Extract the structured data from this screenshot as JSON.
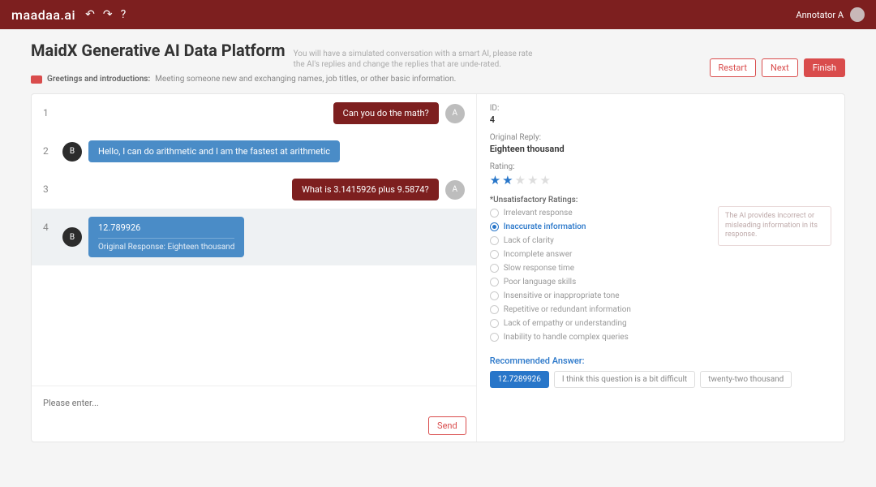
{
  "topbar": {
    "logo": "maadaa.ai",
    "user": "Annotator A"
  },
  "header": {
    "title": "MaidX Generative AI Data Platform",
    "subtitle": "You will have a simulated conversation with a smart AI, please rate the AI's replies and change the replies that are unde-rated.",
    "tag_label": "Greetings and introductions:",
    "tag_desc": "Meeting someone new and exchanging names, job titles, or other basic information.",
    "restart": "Restart",
    "next": "Next",
    "finish": "Finish"
  },
  "chat": {
    "messages": [
      {
        "num": "1",
        "side": "user",
        "avatar": "A",
        "text": "Can you do the math?"
      },
      {
        "num": "2",
        "side": "ai",
        "avatar": "B",
        "text": "Hello, I can do arithmetic and I am the fastest at arithmetic"
      },
      {
        "num": "3",
        "side": "user",
        "avatar": "A",
        "text": "What is 3.1415926 plus 9.5874?"
      },
      {
        "num": "4",
        "side": "ai",
        "avatar": "B",
        "text": "12.789926",
        "orig": "Original Response: Eighteen thousand",
        "selected": true
      }
    ],
    "placeholder": "Please enter...",
    "send": "Send"
  },
  "panel": {
    "id_label": "ID:",
    "id_val": "4",
    "orig_label": "Original Reply:",
    "orig_val": "Eighteen thousand",
    "rating_label": "Rating:",
    "rating": 2,
    "unsat_label": "*Unsatisfactory Ratings:",
    "reasons": [
      "Irrelevant response",
      "Inaccurate information",
      "Lack of clarity",
      "Incomplete answer",
      "Slow response time",
      "Poor language skills",
      "Insensitive or inappropriate tone",
      "Repetitive or redundant information",
      "Lack of empathy or understanding",
      "Inability to handle complex queries"
    ],
    "reason_selected": 1,
    "hint": "The AI provides incorrect or misleading information in its response.",
    "rec_label": "Recommended Answer:",
    "recs": [
      "12.7289926",
      "I think this question is a bit difficult",
      "twenty-two thousand"
    ],
    "rec_selected": 0
  }
}
